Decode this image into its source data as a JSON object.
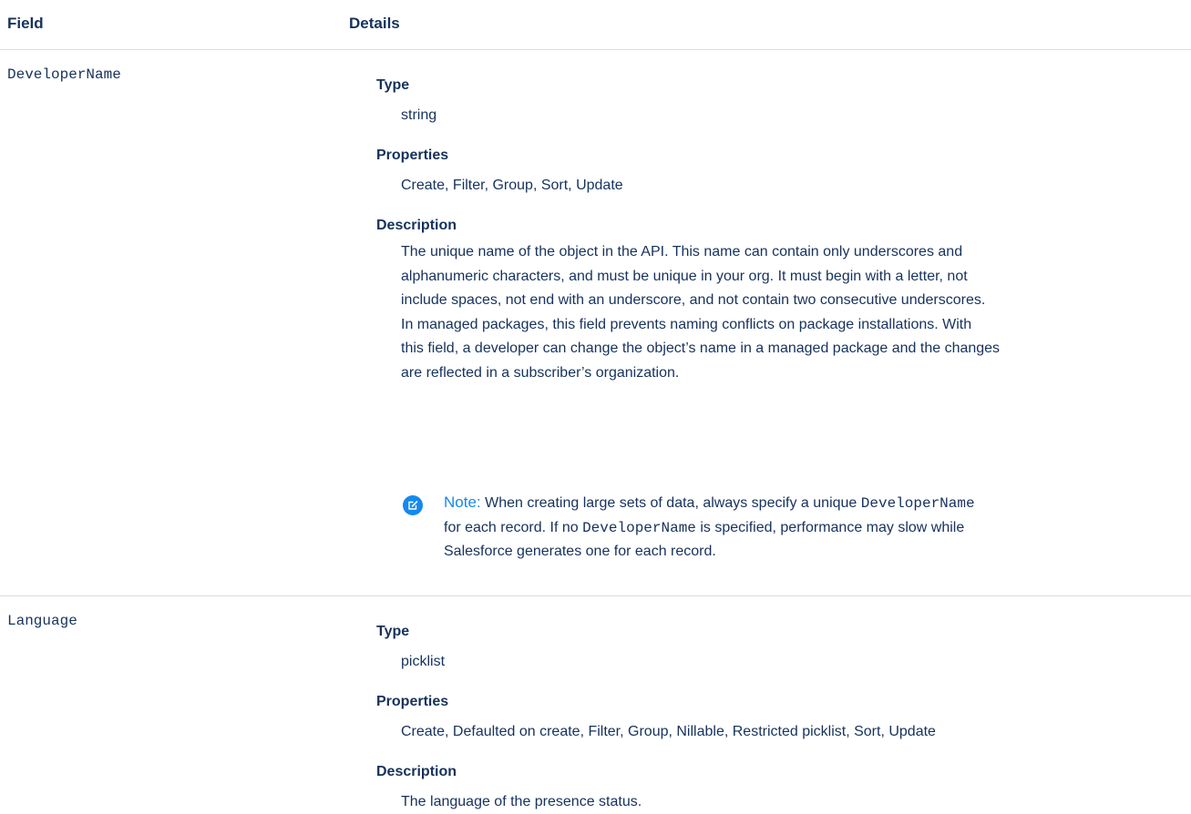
{
  "header": {
    "field_col": "Field",
    "details_col": "Details"
  },
  "rows": [
    {
      "field": "DeveloperName",
      "type_label": "Type",
      "type_value": "string",
      "properties_label": "Properties",
      "properties_value": "Create, Filter, Group, Sort, Update",
      "description_label": "Description",
      "description_lines": [
        "The unique name of the object in the API. This name can contain only underscores and",
        "alphanumeric characters, and must be unique in your org. It must begin with a letter, not",
        "include spaces, not end with an underscore, and not contain two consecutive underscores.",
        "In managed packages, this field prevents naming conflicts on package installations. With",
        "this field, a developer can change the object’s name in a managed package and the changes",
        "are reflected in a subscriber’s organization."
      ],
      "note": {
        "label": "Note:",
        "text_1": " When creating large sets of data, always specify a unique ",
        "code_1": "DeveloperName",
        "text_2": "for each record. If no ",
        "code_2": "DeveloperName",
        "text_3": " is specified, performance may slow while",
        "text_4": "Salesforce generates one for each record."
      }
    },
    {
      "field": "Language",
      "type_label": "Type",
      "type_value": "picklist",
      "properties_label": "Properties",
      "properties_value": "Create, Defaulted on create, Filter, Group, Nillable, Restricted picklist, Sort, Update",
      "description_label": "Description",
      "description_value": "The language of the presence status."
    }
  ]
}
